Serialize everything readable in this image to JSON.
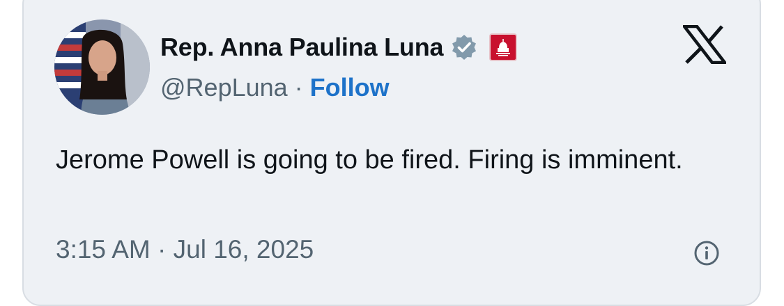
{
  "tweet": {
    "author": {
      "name": "Rep. Anna Paulina Luna",
      "handle": "@RepLuna",
      "follow_label": "Follow",
      "avatar_icon": "profile-photo"
    },
    "separator": "·",
    "text": "Jerome Powell is going to be fired. Firing is imminent.",
    "timestamp": "3:15 AM · Jul 16, 2025",
    "icons": {
      "verified": "verified-badge-icon",
      "affiliation": "house-gop-affiliation-icon",
      "brand": "x-logo-icon",
      "info": "info-icon"
    }
  },
  "colors": {
    "card_bg": "#eef1f5",
    "text": "#0f1419",
    "muted": "#536471",
    "link": "#1d72c9",
    "verified_badge": "#829aab",
    "affiliation_red": "#c8102e"
  }
}
